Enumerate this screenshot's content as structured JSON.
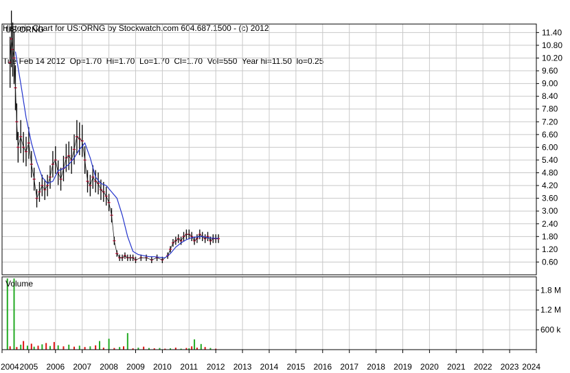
{
  "header": {
    "line1": "Historic Chart for US:ORNG by Stockwatch.com 604.687.1500 - (c) 2012",
    "line2": "Tue Feb 14 2012  Op=1.70  Hi=1.70  Lo=1.70  Cl=1.70  Vol=550  Year hi=11.50  lo=0.25"
  },
  "chart_data": {
    "type": "line",
    "symbol_label": "US:ORNG",
    "volume_label": "Volume",
    "price_ticks": [
      "11.40",
      "10.80",
      "10.20",
      "9.60",
      "9.00",
      "8.40",
      "7.80",
      "7.20",
      "6.60",
      "6.00",
      "5.40",
      "4.80",
      "4.20",
      "3.60",
      "3.00",
      "2.40",
      "1.80",
      "1.20",
      "0.60"
    ],
    "volume_ticks": [
      "1.8 M",
      "1.2 M",
      "600 k"
    ],
    "x_labels": [
      "2004",
      "2005",
      "2006",
      "2007",
      "2008",
      "2009",
      "2010",
      "2011",
      "2012",
      "2013",
      "2014",
      "2015",
      "2016",
      "2017",
      "2018",
      "2019",
      "2020",
      "2021",
      "2022",
      "2023",
      "2024"
    ],
    "ylim": [
      0,
      11.8
    ],
    "xlim": [
      2004,
      2024
    ],
    "price_series": {
      "name": "",
      "x": [
        2004.3,
        2004.35,
        2004.4,
        2004.45,
        2004.5,
        2004.55,
        2004.6,
        2004.7,
        2004.8,
        2004.9,
        2005.0,
        2005.1,
        2005.2,
        2005.3,
        2005.4,
        2005.5,
        2005.6,
        2005.7,
        2005.8,
        2005.9,
        2006.0,
        2006.1,
        2006.2,
        2006.3,
        2006.4,
        2006.5,
        2006.6,
        2006.7,
        2006.8,
        2006.9,
        2007.0,
        2007.1,
        2007.2,
        2007.3,
        2007.4,
        2007.5,
        2007.6,
        2007.7,
        2007.8,
        2007.9,
        2008.0,
        2008.1,
        2008.2,
        2008.3,
        2008.4,
        2008.5,
        2008.6,
        2008.7,
        2008.8,
        2008.9,
        2009.0,
        2009.2,
        2009.4,
        2009.6,
        2009.8,
        2010.0,
        2010.2,
        2010.3,
        2010.4,
        2010.5,
        2010.6,
        2010.7,
        2010.8,
        2010.9,
        2011.0,
        2011.1,
        2011.2,
        2011.3,
        2011.4,
        2011.5,
        2011.6,
        2011.7,
        2011.8,
        2011.9,
        2012.0,
        2012.1
      ],
      "y": [
        10.0,
        11.1,
        10.6,
        10.2,
        8.8,
        7.2,
        6.0,
        6.5,
        6.0,
        5.8,
        6.2,
        5.2,
        4.5,
        3.6,
        3.9,
        4.2,
        4.0,
        4.2,
        4.6,
        5.2,
        5.4,
        4.8,
        4.5,
        5.0,
        5.5,
        5.6,
        5.4,
        5.9,
        6.5,
        6.4,
        6.3,
        5.4,
        4.4,
        4.2,
        4.6,
        4.4,
        4.3,
        4.0,
        3.9,
        3.7,
        3.4,
        2.8,
        1.6,
        1.0,
        0.8,
        0.8,
        0.9,
        0.8,
        0.8,
        0.8,
        0.7,
        0.8,
        0.8,
        0.7,
        0.8,
        0.7,
        0.9,
        1.2,
        1.5,
        1.6,
        1.7,
        1.6,
        1.8,
        1.9,
        1.9,
        1.8,
        1.6,
        1.7,
        1.9,
        1.8,
        1.7,
        1.8,
        1.6,
        1.7,
        1.7,
        1.7
      ]
    },
    "ma_series": {
      "name": "",
      "x": [
        2004.5,
        2004.7,
        2004.9,
        2005.1,
        2005.3,
        2005.5,
        2005.7,
        2005.9,
        2006.1,
        2006.3,
        2006.5,
        2006.7,
        2006.9,
        2007.1,
        2007.3,
        2007.5,
        2007.7,
        2007.9,
        2008.1,
        2008.3,
        2008.5,
        2008.7,
        2008.9,
        2009.1,
        2009.3,
        2009.5,
        2009.7,
        2009.9,
        2010.1,
        2010.3,
        2010.5,
        2010.7,
        2010.9,
        2011.1,
        2011.3,
        2011.5,
        2011.7,
        2011.9,
        2012.1
      ],
      "y": [
        10.5,
        9.0,
        7.4,
        6.2,
        5.3,
        4.6,
        4.3,
        4.4,
        4.9,
        5.0,
        5.2,
        5.5,
        5.9,
        6.2,
        5.5,
        4.6,
        4.3,
        4.2,
        3.9,
        3.6,
        2.8,
        1.8,
        1.1,
        0.95,
        0.9,
        0.85,
        0.85,
        0.82,
        0.8,
        1.0,
        1.3,
        1.5,
        1.65,
        1.75,
        1.78,
        1.8,
        1.75,
        1.72,
        1.72
      ]
    },
    "volume_series": {
      "name": "",
      "x": [
        2004.2,
        2004.3,
        2004.45,
        2004.55,
        2004.7,
        2004.8,
        2004.95,
        2005.1,
        2005.2,
        2005.35,
        2005.5,
        2005.65,
        2005.8,
        2005.95,
        2006.1,
        2006.3,
        2006.5,
        2006.7,
        2006.9,
        2007.1,
        2007.3,
        2007.5,
        2007.65,
        2007.8,
        2008.0,
        2008.2,
        2008.4,
        2008.55,
        2008.7,
        2008.9,
        2009.1,
        2009.3,
        2009.5,
        2009.7,
        2009.9,
        2010.1,
        2010.3,
        2010.5,
        2010.7,
        2010.9,
        2011.0,
        2011.1,
        2011.2,
        2011.3,
        2011.45,
        2011.6,
        2011.8,
        2012.0
      ],
      "y": [
        2150000,
        100000,
        2150000,
        80000,
        150000,
        260000,
        120000,
        180000,
        90000,
        120000,
        160000,
        200000,
        110000,
        230000,
        130000,
        100000,
        150000,
        90000,
        120000,
        80000,
        100000,
        130000,
        260000,
        60000,
        330000,
        50000,
        80000,
        100000,
        500000,
        40000,
        60000,
        90000,
        50000,
        40000,
        50000,
        30000,
        40000,
        60000,
        30000,
        50000,
        40000,
        100000,
        310000,
        60000,
        170000,
        80000,
        50000,
        30000
      ]
    }
  }
}
